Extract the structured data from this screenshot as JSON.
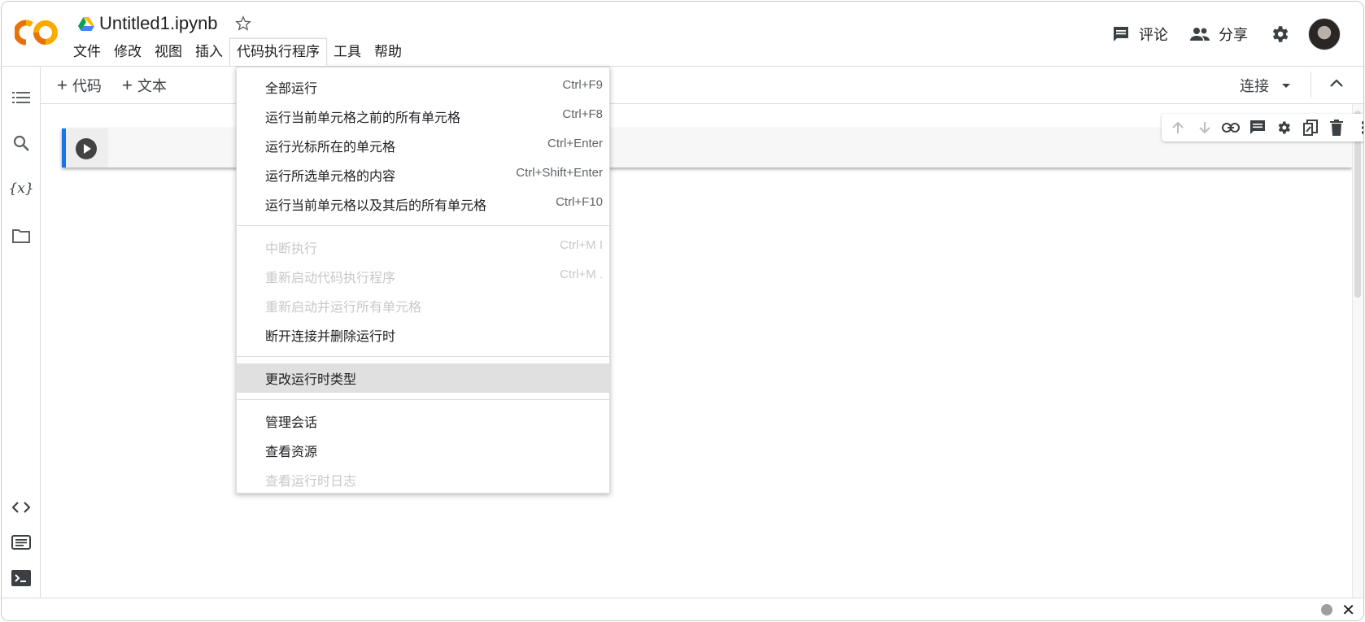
{
  "header": {
    "doc_title": "Untitled1.ipynb",
    "menu": [
      "文件",
      "修改",
      "视图",
      "插入",
      "代码执行程序",
      "工具",
      "帮助"
    ],
    "comment_label": "评论",
    "share_label": "分享"
  },
  "toolbar": {
    "add_code_label": "代码",
    "add_text_label": "文本",
    "connect_label": "连接"
  },
  "sidebar": {
    "icons": [
      "toc-icon",
      "search-icon",
      "variables-icon",
      "folder-icon",
      "code-snippets-icon",
      "command-palette-icon",
      "terminal-icon"
    ],
    "variables_glyph": "{x}"
  },
  "dropdown": {
    "groups": [
      [
        {
          "label": "全部运行",
          "shortcut": "Ctrl+F9",
          "disabled": false
        },
        {
          "label": "运行当前单元格之前的所有单元格",
          "shortcut": "Ctrl+F8",
          "disabled": false
        },
        {
          "label": "运行光标所在的单元格",
          "shortcut": "Ctrl+Enter",
          "disabled": false
        },
        {
          "label": "运行所选单元格的内容",
          "shortcut": "Ctrl+Shift+Enter",
          "disabled": false
        },
        {
          "label": "运行当前单元格以及其后的所有单元格",
          "shortcut": "Ctrl+F10",
          "disabled": false
        }
      ],
      [
        {
          "label": "中断执行",
          "shortcut": "Ctrl+M I",
          "disabled": true
        },
        {
          "label": "重新启动代码执行程序",
          "shortcut": "Ctrl+M .",
          "disabled": true
        },
        {
          "label": "重新启动并运行所有单元格",
          "shortcut": "",
          "disabled": true
        },
        {
          "label": "断开连接并删除运行时",
          "shortcut": "",
          "disabled": false
        }
      ],
      [
        {
          "label": "更改运行时类型",
          "shortcut": "",
          "disabled": false,
          "hover": true
        }
      ],
      [
        {
          "label": "管理会话",
          "shortcut": "",
          "disabled": false
        },
        {
          "label": "查看资源",
          "shortcut": "",
          "disabled": false
        },
        {
          "label": "查看运行时日志",
          "shortcut": "",
          "disabled": true
        }
      ]
    ]
  },
  "colors": {
    "logo_orange": "#f9ab00",
    "logo_dark_orange": "#e8710a",
    "cell_accent": "#1a73e8"
  }
}
